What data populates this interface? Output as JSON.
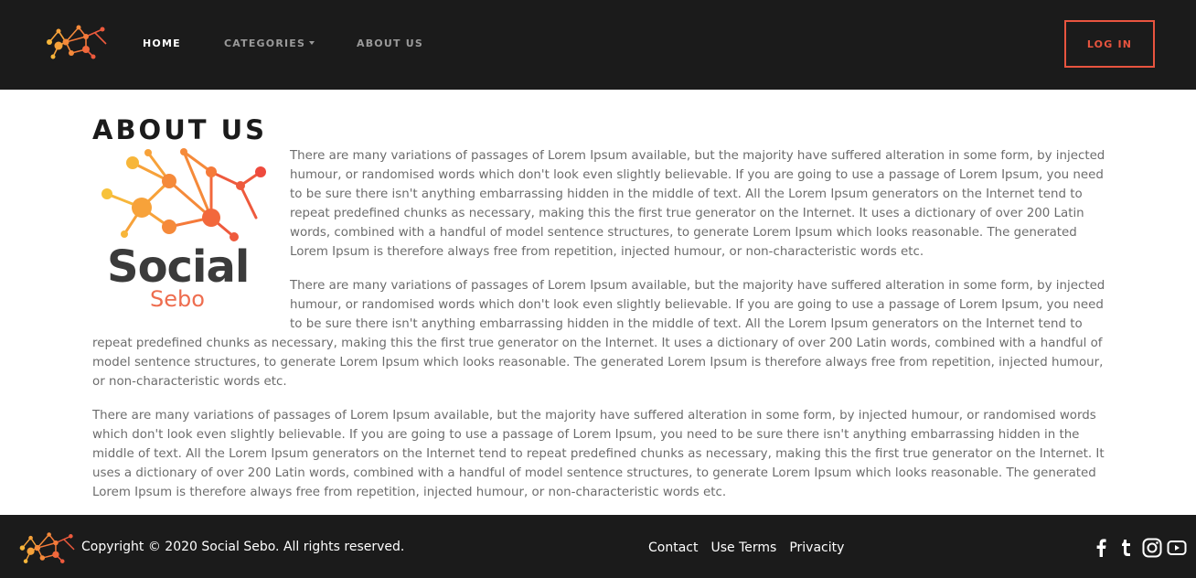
{
  "nav": {
    "logo_icon": "network-nodes-logo",
    "home": "HOME",
    "categories": "CATEGORIES",
    "about": "ABOUT US",
    "login": "LOG IN",
    "login_color": "#e8543f"
  },
  "main": {
    "title": "ABOUT US",
    "logo": {
      "name": "Social",
      "sub": "Sebo"
    },
    "paragraphs": [
      "There are many variations of passages of Lorem Ipsum available, but the majority have suffered alteration in some form, by injected humour, or randomised words which don't look even slightly believable. If you are going to use a passage of Lorem Ipsum, you need to be sure there isn't anything embarrassing hidden in the middle of text. All the Lorem Ipsum generators on the Internet tend to repeat predefined chunks as necessary, making this the first true generator on the Internet. It uses a dictionary of over 200 Latin words, combined with a handful of model sentence structures, to generate Lorem Ipsum which looks reasonable. The generated Lorem Ipsum is therefore always free from repetition, injected humour, or non-characteristic words etc.",
      "There are many variations of passages of Lorem Ipsum available, but the majority have suffered alteration in some form, by injected humour, or randomised words which don't look even slightly believable. If you are going to use a passage of Lorem Ipsum, you need to be sure there isn't anything embarrassing hidden in the middle of text. All the Lorem Ipsum generators on the Internet tend to repeat predefined chunks as necessary, making this the first true generator on the Internet. It uses a dictionary of over 200 Latin words, combined with a handful of model sentence structures, to generate Lorem Ipsum which looks reasonable. The generated Lorem Ipsum is therefore always free from repetition, injected humour, or non-characteristic words etc.",
      "There are many variations of passages of Lorem Ipsum available, but the majority have suffered alteration in some form, by injected humour, or randomised words which don't look even slightly believable. If you are going to use a passage of Lorem Ipsum, you need to be sure there isn't anything embarrassing hidden in the middle of text. All the Lorem Ipsum generators on the Internet tend to repeat predefined chunks as necessary, making this the first true generator on the Internet. It uses a dictionary of over 200 Latin words, combined with a handful of model sentence structures, to generate Lorem Ipsum which looks reasonable. The generated Lorem Ipsum is therefore always free from repetition, injected humour, or non-characteristic words etc."
    ]
  },
  "footer": {
    "copyright": "Copyright © 2020 Social Sebo. All rights reserved.",
    "links": [
      "Contact",
      "Use Terms",
      "Privacity"
    ],
    "social_icons": [
      "facebook-icon",
      "tumblr-icon",
      "instagram-icon",
      "youtube-icon"
    ]
  },
  "colors": {
    "dark": "#1b1b1b",
    "accent": "#e8543f",
    "orange": "#f7a23a",
    "body_text": "#6c6c6c"
  }
}
